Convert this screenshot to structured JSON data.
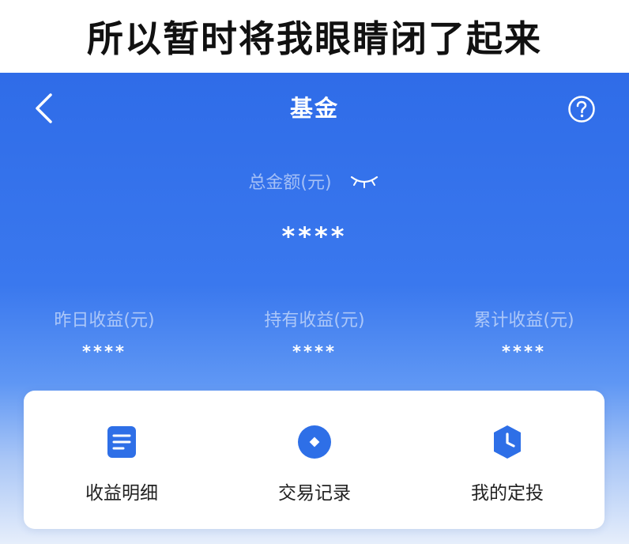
{
  "caption": {
    "text": "所以暂时将我眼睛闭了起来"
  },
  "nav": {
    "title": "基金"
  },
  "summary": {
    "total_label": "总金额(元)",
    "total_value": "****"
  },
  "stats": [
    {
      "label": "昨日收益(元)",
      "value": "****"
    },
    {
      "label": "持有收益(元)",
      "value": "****"
    },
    {
      "label": "累计收益(元)",
      "value": "****"
    }
  ],
  "actions": [
    {
      "label": "收益明细",
      "icon": "document-icon"
    },
    {
      "label": "交易记录",
      "icon": "record-icon"
    },
    {
      "label": "我的定投",
      "icon": "clock-shield-icon"
    }
  ],
  "colors": {
    "primary_blue": "#2f6ce8",
    "icon_blue": "#2e6fe7",
    "white": "#ffffff"
  }
}
